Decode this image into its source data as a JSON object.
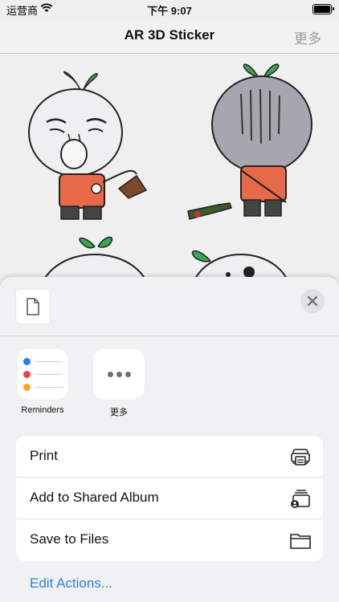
{
  "status_bar": {
    "carrier": "运营商",
    "time": "下午 9:07"
  },
  "nav": {
    "title": "AR 3D Sticker",
    "more_label": "更多"
  },
  "share_sheet": {
    "apps": [
      {
        "label": "Reminders",
        "icon": "reminders-icon"
      },
      {
        "label": "更多",
        "icon": "more-dots-icon"
      }
    ],
    "actions": [
      {
        "label": "Print",
        "icon": "printer-icon"
      },
      {
        "label": "Add to Shared Album",
        "icon": "shared-album-icon"
      },
      {
        "label": "Save to Files",
        "icon": "folder-icon"
      }
    ],
    "edit_actions_label": "Edit Actions..."
  },
  "colors": {
    "accent_blue": "#2d7ff0",
    "reminder_blue": "#1e7ff0",
    "reminder_red": "#f0433a",
    "reminder_orange": "#f5a623"
  }
}
